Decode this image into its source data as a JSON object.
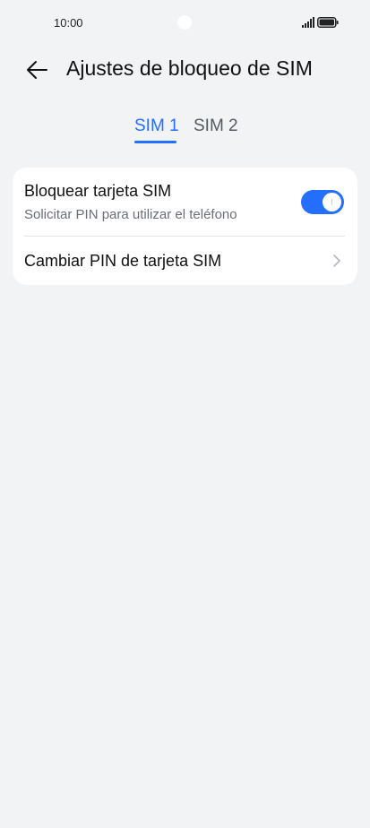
{
  "status_bar": {
    "time": "10:00",
    "icons": [
      "signal-icon",
      "battery-icon"
    ]
  },
  "header": {
    "back_icon": "arrow-left-icon",
    "title": "Ajustes de bloqueo de SIM"
  },
  "tabs": [
    {
      "label": "SIM 1",
      "active": true
    },
    {
      "label": "SIM 2",
      "active": false
    }
  ],
  "settings": {
    "lock_sim": {
      "title": "Bloquear tarjeta SIM",
      "subtitle": "Solicitar PIN para utilizar el teléfono",
      "enabled": true
    },
    "change_pin": {
      "title": "Cambiar PIN de tarjeta SIM",
      "icon": "chevron-right-icon"
    }
  },
  "colors": {
    "accent": "#256fff",
    "background": "#f1f3f5",
    "card": "#ffffff"
  }
}
